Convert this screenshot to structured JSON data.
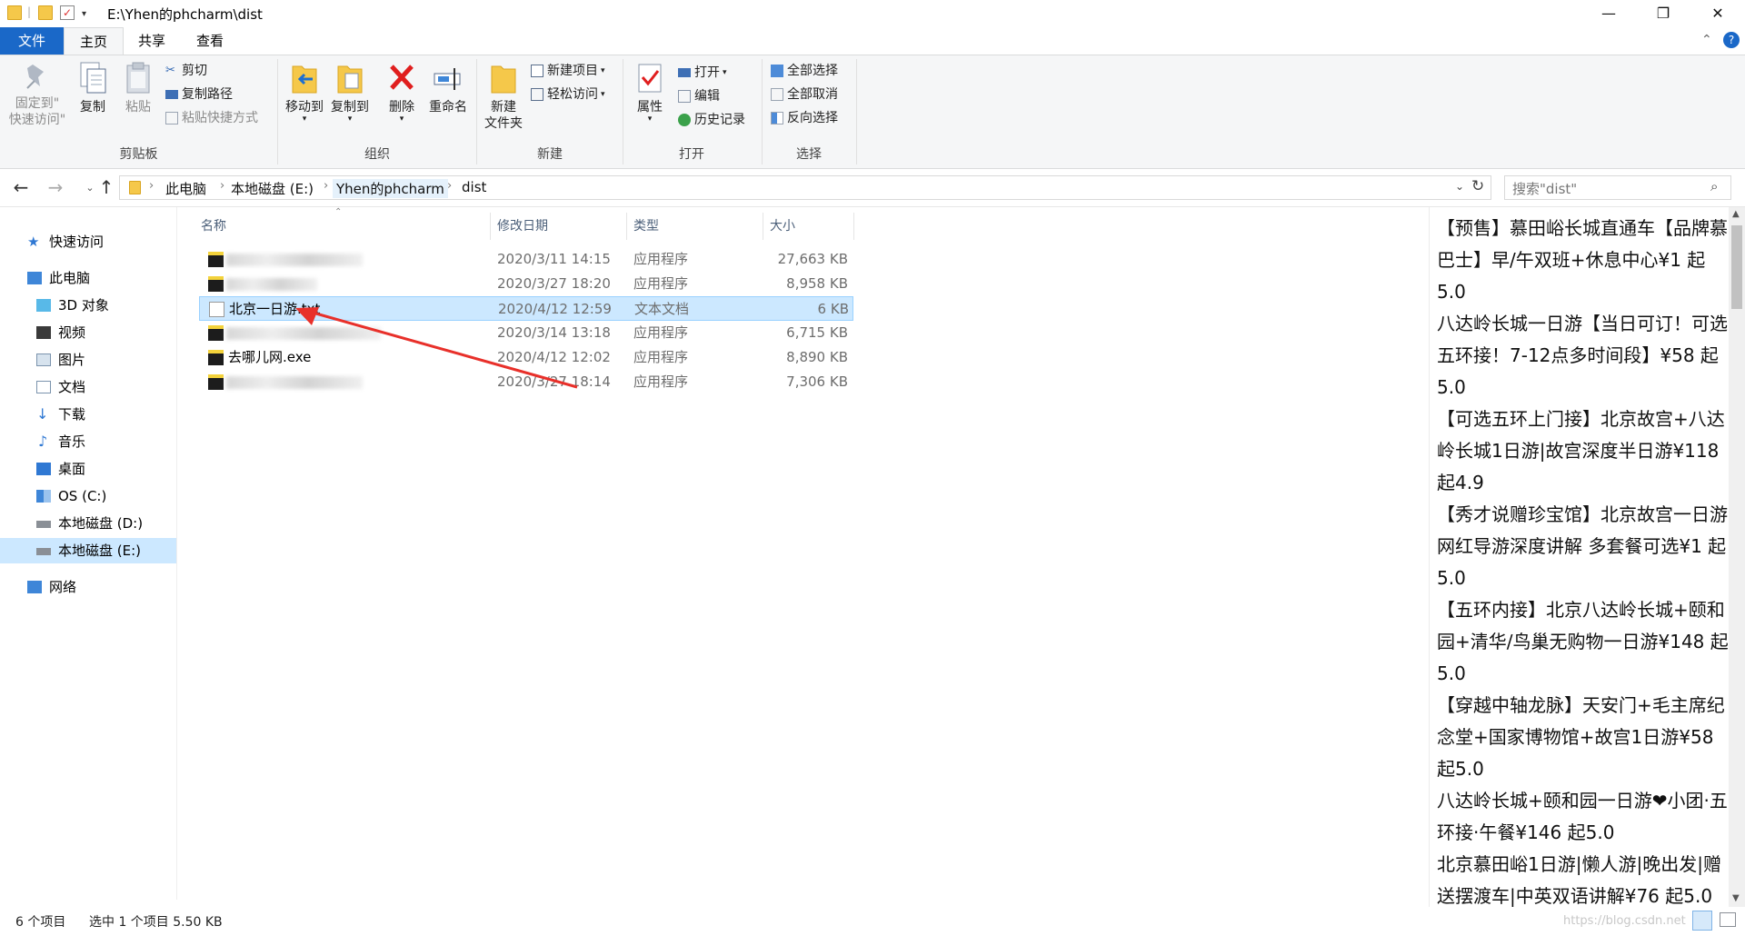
{
  "window": {
    "title_path": "E:\\Yhen的phcharm\\dist",
    "controls": {
      "minimize": "—",
      "maximize": "❐",
      "close": "✕"
    }
  },
  "ribbon_tabs": [
    "文件",
    "主页",
    "共享",
    "查看"
  ],
  "ribbon": {
    "clipboard": {
      "label": "剪贴板",
      "pin_line1": "固定到\"",
      "pin_line2": "快速访问\"",
      "copy": "复制",
      "paste": "粘贴",
      "cut": "剪切",
      "copy_path": "复制路径",
      "paste_shortcut": "粘贴快捷方式"
    },
    "organize": {
      "label": "组织",
      "move_to": "移动到",
      "copy_to": "复制到",
      "delete": "删除",
      "rename": "重命名"
    },
    "new": {
      "label": "新建",
      "new_folder_line1": "新建",
      "new_folder_line2": "文件夹",
      "new_item": "新建项目",
      "easy_access": "轻松访问"
    },
    "open": {
      "label": "打开",
      "properties": "属性",
      "open": "打开",
      "edit": "编辑",
      "history": "历史记录"
    },
    "select": {
      "label": "选择",
      "select_all": "全部选择",
      "select_none": "全部取消",
      "invert": "反向选择"
    }
  },
  "address": {
    "crumbs": [
      "此电脑",
      "本地磁盘 (E:)",
      "Yhen的phcharm",
      "dist"
    ],
    "search_placeholder": "搜索\"dist\""
  },
  "nav": {
    "quick_access": "快速访问",
    "this_pc": "此电脑",
    "items": [
      "3D 对象",
      "视频",
      "图片",
      "文档",
      "下载",
      "音乐",
      "桌面",
      "OS (C:)",
      "本地磁盘 (D:)",
      "本地磁盘 (E:)"
    ],
    "network": "网络"
  },
  "columns": {
    "name": "名称",
    "date": "修改日期",
    "type": "类型",
    "size": "大小"
  },
  "files": [
    {
      "name": "",
      "date": "2020/3/11 14:15",
      "type": "应用程序",
      "size": "27,663 KB",
      "icon": "exe-icon",
      "blurred": true
    },
    {
      "name": "",
      "date": "2020/3/27 18:20",
      "type": "应用程序",
      "size": "8,958 KB",
      "icon": "exe-icon",
      "blurred": true
    },
    {
      "name": "北京一日游.txt",
      "date": "2020/4/12 12:59",
      "type": "文本文档",
      "size": "6 KB",
      "icon": "txt-icon",
      "blurred": false,
      "selected": true
    },
    {
      "name": "",
      "date": "2020/3/14 13:18",
      "type": "应用程序",
      "size": "6,715 KB",
      "icon": "exe-icon",
      "blurred": true
    },
    {
      "name": "去哪儿网.exe",
      "date": "2020/4/12 12:02",
      "type": "应用程序",
      "size": "8,890 KB",
      "icon": "exe-icon",
      "blurred": false
    },
    {
      "name": "",
      "date": "2020/3/27 18:14",
      "type": "应用程序",
      "size": "7,306 KB",
      "icon": "exe-icon",
      "blurred": true
    }
  ],
  "preview_text": "【预售】慕田峪长城直通车【品牌慕巴士】早/午双班+休息中心¥1 起5.0\n八达岭长城一日游【当日可订！可选五环接！7-12点多时间段】¥58 起5.0\n【可选五环上门接】北京故宫+八达岭长城1日游|故宫深度半日游¥118 起4.9\n【秀才说赠珍宝馆】北京故宫一日游网红导游深度讲解 多套餐可选¥1 起5.0\n【五环内接】北京八达岭长城+颐和园+清华/鸟巢无购物一日游¥148 起5.0\n【穿越中轴龙脉】天安门+毛主席纪念堂+国家博物馆+故宫1日游¥58 起5.0\n八达岭长城+颐和园一日游❤小团·五环接·午餐¥146 起5.0\n北京慕田峪1日游|懒人游|晚出发|赠送摆渡车|中英双语讲解¥76 起5.0",
  "status": {
    "count": "6 个项目",
    "selection": "选中 1 个项目  5.50 KB",
    "watermark": "https://blog.csdn.net"
  }
}
